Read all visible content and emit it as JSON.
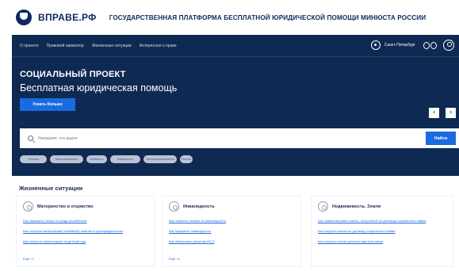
{
  "header": {
    "logo_text": "ВПРАВЕ.РФ",
    "site_title": "ГОСУДАРСТВЕННАЯ ПЛАТФОРМА БЕСПЛАТНОЙ ЮРИДИЧЕСКОЙ ПОМОЩИ МИНЮСТА РОССИИ"
  },
  "nav": {
    "items": [
      "О проекте",
      "Правовой навигатор",
      "Жизненные ситуации",
      "Интересное о праве"
    ],
    "city": "Санкт-Петербург"
  },
  "hero": {
    "title": "СОЦИАЛЬНЫЙ ПРОЕКТ",
    "subtitle": "Бесплатная юридическая помощь",
    "button_label": "Узнать больше",
    "prev_arrow": "‹",
    "next_arrow": "›"
  },
  "search": {
    "placeholder": "Напишите, что ищете",
    "button_label": "Найти",
    "chips": [
      "Ипотека",
      "Налоговый вычет",
      "Алименты",
      "Банкротство",
      "Материнский капитал",
      "Пенсия"
    ]
  },
  "life_situations": {
    "title": "Жизненные ситуации",
    "cards": [
      {
        "title": "Материнство и отцовство",
        "links": [
          "Как оформить отпуск по уходу за ребенком",
          "Как получить материнский (семейный) капитал и распорядиться им",
          "Как получить компенсацию за детский сад"
        ],
        "all_link": "Ещё +2"
      },
      {
        "title": "Инвалидность",
        "links": [
          "Как получить пенсию по инвалидности",
          "Как оформить инвалидность",
          "Как обжаловать решение МСЭ"
        ],
        "all_link": "Ещё +4"
      },
      {
        "title": "Недвижимость. Земля",
        "links": [
          "Как приватизировать жилье, полученное по договору социального найма",
          "Как получить жилье по договору социального найма",
          "Как получить жилье для многодетной семьи"
        ],
        "all_link": ""
      }
    ]
  },
  "colors": {
    "hero_bg": "#0f2a52",
    "accent": "#1a6be0",
    "brand": "#0d2a5c"
  }
}
